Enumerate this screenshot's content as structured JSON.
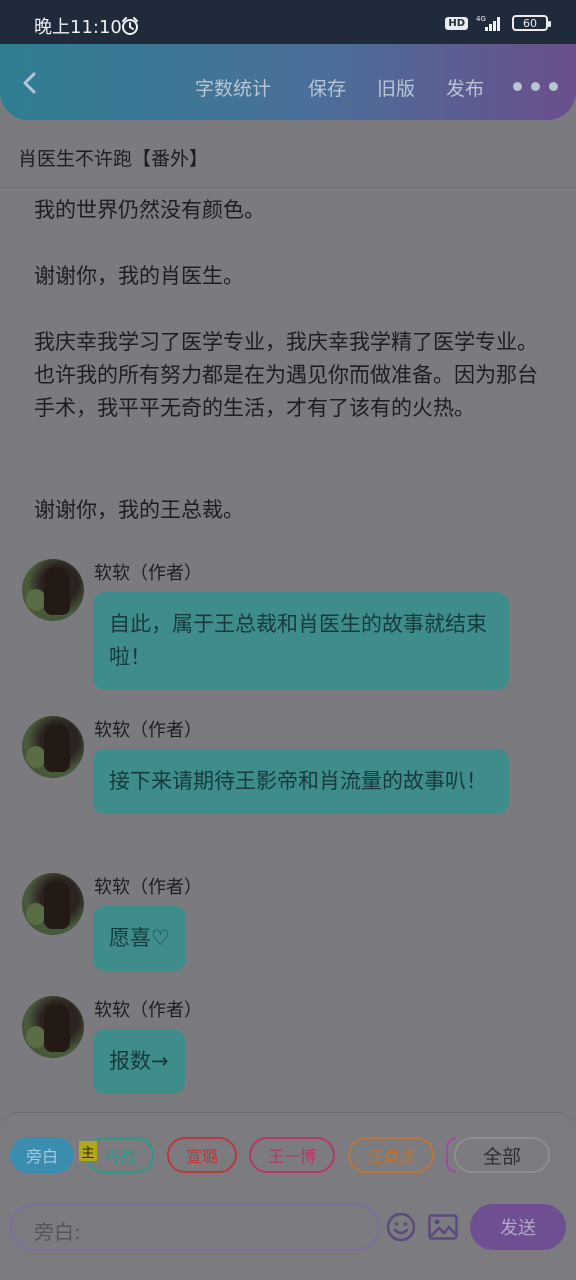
{
  "status": {
    "time": "晚上11:10",
    "alarm_icon": "alarm-clock-icon",
    "hd": "HD",
    "network": "4G",
    "battery": "60"
  },
  "toolbar": {
    "back_icon": "chevron-left-icon",
    "word_count": "字数统计",
    "save": "保存",
    "old_version": "旧版",
    "publish": "发布",
    "more_icon": "more-dots-icon"
  },
  "page": {
    "title": "肖医生不许跑【番外】"
  },
  "narration": [
    "我的世界仍然没有颜色。",
    "谢谢你，我的肖医生。",
    "我庆幸我学习了医学专业，我庆幸我学精了医学专业。也许我的所有努力都是在为遇见你而做准备。因为那台手术，我平平无奇的生活，才有了该有的火热。",
    "谢谢你，我的王总裁。"
  ],
  "messages": [
    {
      "author": "软软（作者）",
      "text": "自此，属于王总裁和肖医生的故事就结束啦！"
    },
    {
      "author": "软软（作者）",
      "text": "接下来请期待王影帝和肖流量的故事叭！"
    },
    {
      "author": "软软（作者）",
      "text": "愿喜♡"
    },
    {
      "author": "软软（作者）",
      "text": "报数→"
    }
  ],
  "roles": {
    "narrator": "旁白",
    "main_badge": "主",
    "xiaozhan": "肖战",
    "xuanlu": "宣璐",
    "wangyibo": "王一博",
    "wangzhuocheng": "汪卓成",
    "all": "全部"
  },
  "composer": {
    "placeholder": "旁白:",
    "emoji_icon": "emoji-smile-icon",
    "image_icon": "image-icon",
    "send": "发送"
  },
  "colors": {
    "bubble": "#3f8d8b",
    "send": "#6d4f92",
    "chip_active": "#3b8db0",
    "chip_xiaozhan": "#2a9a8f",
    "chip_xuanlu": "#b83a3a",
    "chip_wangyibo": "#b8366a",
    "chip_wangzhuocheng": "#b8743a",
    "overlay": "#7a7a7f"
  }
}
